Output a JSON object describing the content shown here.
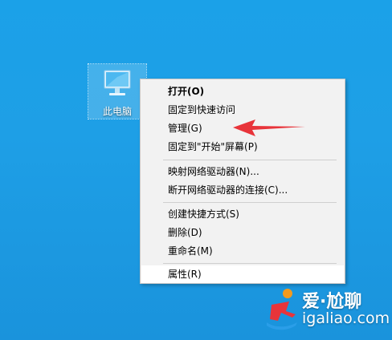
{
  "desktop": {
    "icon_label": "此电脑",
    "icon_name": "computer-icon"
  },
  "context_menu": {
    "items": [
      {
        "label": "打开(O)",
        "bold": true
      },
      {
        "label": "固定到快速访问"
      },
      {
        "label": "管理(G)"
      },
      {
        "label": "固定到\"开始\"屏幕(P)"
      },
      {
        "label": "映射网络驱动器(N)..."
      },
      {
        "label": "断开网络驱动器的连接(C)..."
      },
      {
        "label": "创建快捷方式(S)"
      },
      {
        "label": "删除(D)"
      },
      {
        "label": "重命名(M)"
      },
      {
        "label": "属性(R)",
        "hovered": true
      }
    ]
  },
  "annotation": {
    "arrow_color": "#e8343a",
    "points_to": "管理(G)"
  },
  "watermark": {
    "brand": "爱·尬聊",
    "domain": "igaliao.com"
  },
  "colors": {
    "desktop_background": "#1ba1e8",
    "menu_background": "#f2f2f2",
    "menu_hover": "#ffffff"
  }
}
